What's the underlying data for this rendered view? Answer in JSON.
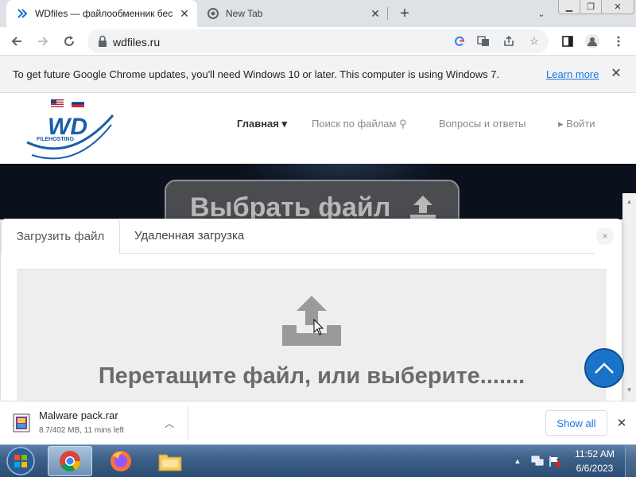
{
  "browser": {
    "tabs": [
      {
        "title": "WDfiles — файлообменник бес",
        "icon": "wdfiles-favicon",
        "active": true
      },
      {
        "title": "New Tab",
        "icon": "chrome-favicon",
        "active": false
      }
    ],
    "new_tab_icon": "plus-icon",
    "address": "wdfiles.ru",
    "omnibox_icons": [
      "google-lens-icon",
      "translate-icon",
      "share-icon",
      "bookmark-star-icon"
    ],
    "toolbar_icons": [
      "back-icon",
      "forward-icon",
      "reload-icon",
      "side-panel-icon",
      "profile-icon",
      "menu-icon"
    ]
  },
  "infobar": {
    "text": "To get future Google Chrome updates, you'll need Windows 10 or later. This computer is using Windows 7.",
    "link": "Learn more"
  },
  "site": {
    "logo_text": "WD",
    "logo_sub": "FILEHOSTING",
    "nav": {
      "home": "Главная ▾",
      "search": "Поиск по файлам",
      "faq": "Вопросы и ответы",
      "login": "Войти"
    },
    "hero_button": "Выбрать файл"
  },
  "modal": {
    "tab_upload": "Загрузить файл",
    "tab_remote": "Удаленная загрузка",
    "close": "×",
    "drop_text": "Перетащите файл, или выберите......."
  },
  "download": {
    "filename": "Malware pack.rar",
    "status": "8.7/402 MB, 11 mins left",
    "show_all": "Show all"
  },
  "taskbar": {
    "apps": [
      "chrome-icon",
      "firefox-icon",
      "file-explorer-icon"
    ],
    "time": "11:52 AM",
    "date": "6/6/2023"
  },
  "colors": {
    "accent_blue": "#1a73e8",
    "scroll_top_button": "#1a73c8",
    "hero_background": "#0b111c",
    "logo_blue": "#1b5fa8"
  }
}
